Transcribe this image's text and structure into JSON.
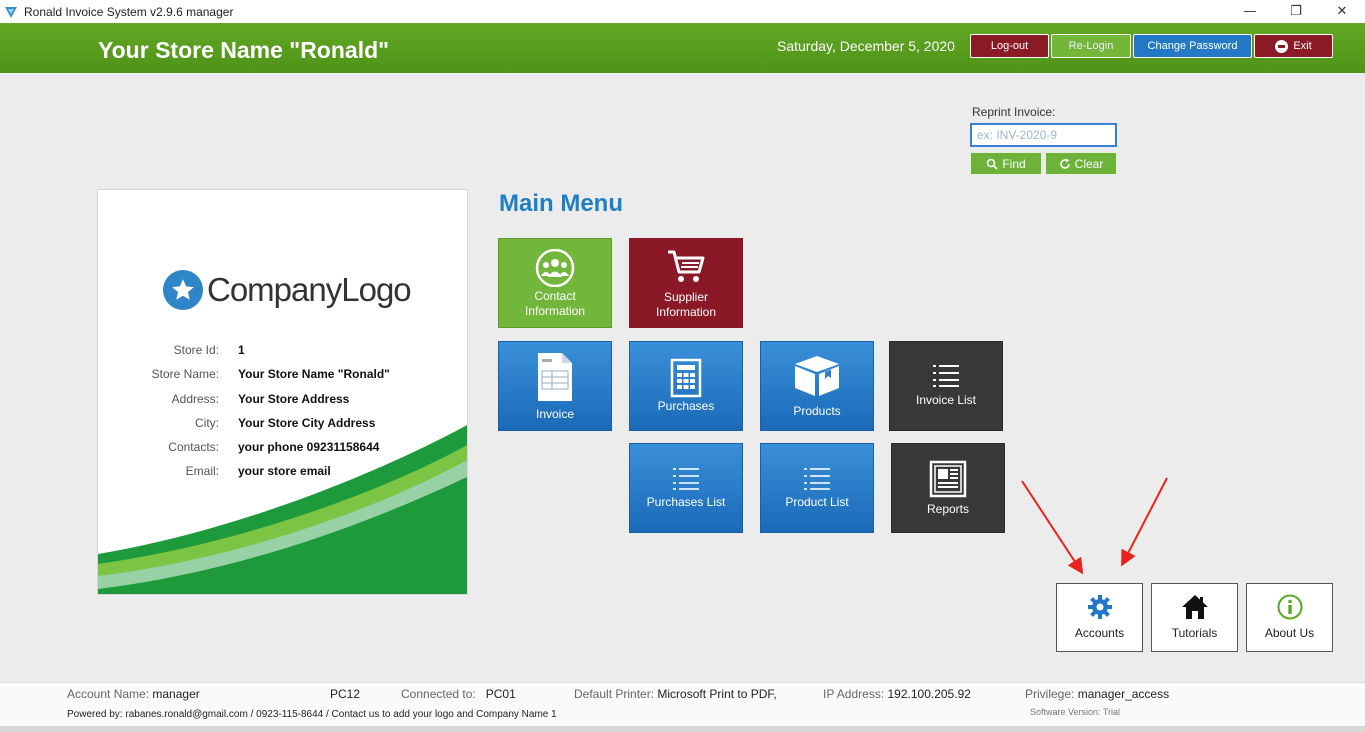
{
  "window": {
    "title": "Ronald Invoice System v2.9.6 manager",
    "minimize": "—",
    "restore": "❐",
    "close": "✕"
  },
  "header": {
    "store_title": "Your Store Name \"Ronald\"",
    "date": "Saturday, December 5, 2020",
    "logout_label": "Log-out",
    "relogin_label": "Re-Login",
    "change_password_label": "Change Password",
    "exit_label": "Exit"
  },
  "reprint": {
    "label": "Reprint Invoice:",
    "placeholder": "ex: INV-2020-9",
    "find_label": "Find",
    "clear_label": "Clear"
  },
  "store_card": {
    "logo_text": "CompanyLogo",
    "rows": [
      {
        "label": "Store Id:",
        "value": "1"
      },
      {
        "label": "Store Name:",
        "value": "Your Store Name \"Ronald\""
      },
      {
        "label": "Address:",
        "value": "Your Store Address"
      },
      {
        "label": "City:",
        "value": "Your Store City Address"
      },
      {
        "label": "Contacts:",
        "value": "your phone 09231158644"
      },
      {
        "label": "Email:",
        "value": "your store email"
      }
    ]
  },
  "main_menu": {
    "title": "Main Menu",
    "tiles": {
      "contact_information": {
        "line1": "Contact",
        "line2": "Information",
        "icon": "users-icon"
      },
      "supplier_information": {
        "line1": "Supplier",
        "line2": "Information",
        "icon": "cart-icon"
      },
      "invoice": {
        "label": "Invoice",
        "icon": "invoice-document-icon"
      },
      "purchases": {
        "label": "Purchases",
        "icon": "purchases-sheet-icon"
      },
      "products": {
        "label": "Products",
        "icon": "box-icon"
      },
      "invoice_list": {
        "label": "Invoice List",
        "icon": "list-icon"
      },
      "purchases_list": {
        "label": "Purchases List",
        "icon": "list-icon"
      },
      "product_list": {
        "label": "Product List",
        "icon": "list-icon"
      },
      "reports": {
        "label": "Reports",
        "icon": "newspaper-icon"
      }
    }
  },
  "footer_buttons": {
    "accounts": {
      "label": "Accounts",
      "icon": "gear-icon"
    },
    "tutorials": {
      "label": "Tutorials",
      "icon": "home-icon"
    },
    "about_us": {
      "label": "About Us",
      "icon": "info-icon"
    }
  },
  "status": {
    "account_name_label": "Account Name:",
    "account_name": "manager",
    "pc": "PC12",
    "connected_to_label": "Connected to:",
    "connected_to": "PC01",
    "default_printer_label": "Default Printer:",
    "default_printer": "Microsoft Print to PDF,",
    "ip_label": "IP Address:",
    "ip": "192.100.205.92",
    "privilege_label": "Privilege:",
    "privilege": "manager_access",
    "powered_by": "Powered by: rabanes.ronald@gmail.com / 0923-115-8644  /  Contact us to add your logo and Company Name 1",
    "software_version": "Software Version: Trial"
  },
  "colors": {
    "header_green": "#5a9e1e",
    "maroon": "#8b1827",
    "blue": "#1f7fc4",
    "dark_tile": "#383838",
    "annotation_red": "#e8231d"
  }
}
